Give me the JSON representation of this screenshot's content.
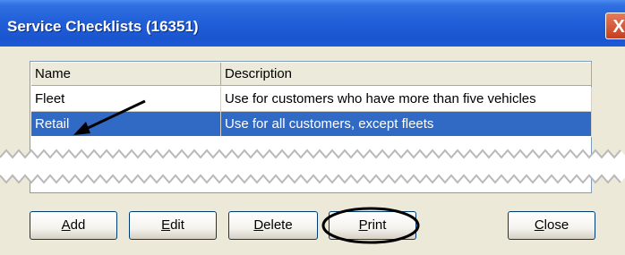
{
  "window": {
    "title": "Service Checklists (16351)",
    "close_glyph": "X"
  },
  "grid": {
    "columns": [
      "Name",
      "Description"
    ],
    "rows": [
      {
        "name": "Fleet",
        "description": "Use for customers who have more than five vehicles",
        "selected": false
      },
      {
        "name": "Retail",
        "description": "Use for all customers, except fleets",
        "selected": true
      }
    ]
  },
  "buttons": [
    {
      "label": "Add",
      "mnemonic": "A",
      "rest": "dd"
    },
    {
      "label": "Edit",
      "mnemonic": "E",
      "rest": "dit"
    },
    {
      "label": "Delete",
      "mnemonic": "D",
      "rest": "elete"
    },
    {
      "label": "Print",
      "mnemonic": "P",
      "rest": "rint"
    },
    {
      "label": "Close",
      "mnemonic": "C",
      "rest": "lose"
    }
  ],
  "annotations": {
    "arrow_target": "Retail",
    "circled_button": "Print",
    "annotation_color": "#000000"
  },
  "colors": {
    "title_bar": "#1f5ed8",
    "selection": "#316ac5",
    "dialog_face": "#ece9d8"
  }
}
